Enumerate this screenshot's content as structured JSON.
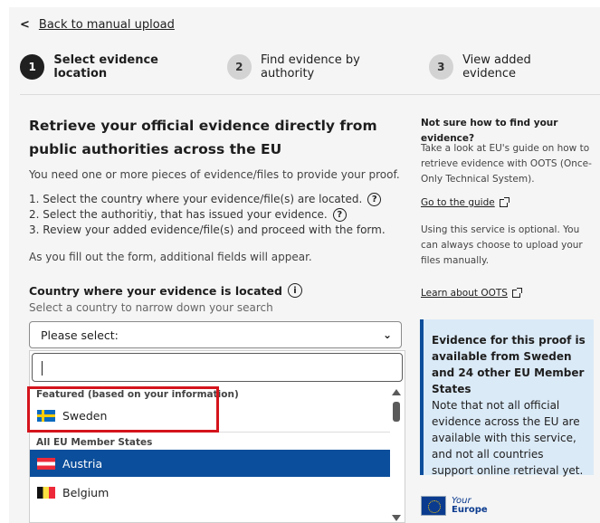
{
  "nav": {
    "back_label": "Back to manual upload"
  },
  "steps": [
    {
      "num": "1",
      "label": "Select evidence location"
    },
    {
      "num": "2",
      "label": "Find evidence by authority"
    },
    {
      "num": "3",
      "label": "View added evidence"
    }
  ],
  "main": {
    "title": "Retrieve your official evidence directly from public authorities across the EU",
    "intro": "You need one or more pieces of evidence/files to provide your proof.",
    "list": [
      "1. Select the country where your evidence/file(s) are located.",
      "2. Select the authoritiy, that has issued your evidence.",
      "3. Review your added evidence/file(s) and proceed with the form."
    ],
    "note": "As you fill out the form, additional fields will appear.",
    "field_label": "Country where your evidence is located",
    "field_hint": "Select a country to narrow down your search",
    "select_value": "Please select:",
    "dropdown": {
      "search_value": "",
      "featured_group": "Featured (based on your information)",
      "featured": [
        {
          "name": "Sweden",
          "flag": "flag-sweden-icon"
        }
      ],
      "all_group": "All EU Member States",
      "countries": [
        {
          "name": "Austria",
          "flag": "flag-austria-icon",
          "selected": true
        },
        {
          "name": "Belgium",
          "flag": "flag-belgium-icon",
          "selected": false
        }
      ]
    }
  },
  "side": {
    "title": "Not sure how to find your evidence?",
    "p1": "Take a look at EU's guide on how to retrieve evidence with OOTS (Once-Only Technical System).",
    "link1": "Go to the guide",
    "p2": "Using this service is optional. You can always choose to upload your files manually.",
    "link2": "Learn about OOTS"
  },
  "infobox": {
    "heading": "Evidence for this proof is available from Sweden and 24 other EU Member States",
    "body": "Note that not all official evidence across the EU are available with this service, and not all countries support online retrieval yet."
  },
  "logo": {
    "line1": "Your",
    "line2": "Europe"
  },
  "colors": {
    "accent": "#0b4e9b",
    "highlight": "#d4141c",
    "infobox_bg": "#dbeaf7"
  }
}
